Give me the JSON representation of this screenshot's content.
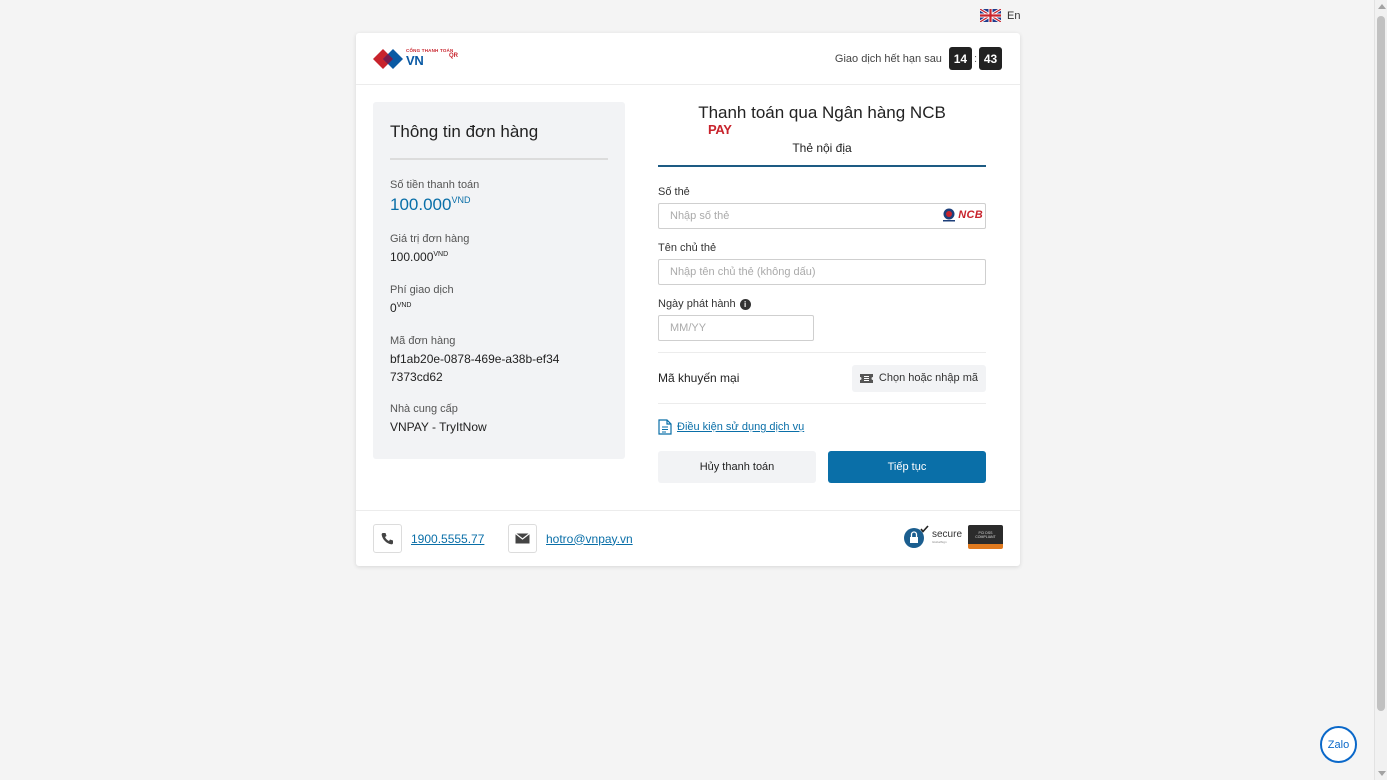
{
  "language": {
    "label": "En",
    "flag_icon": "uk-flag-icon"
  },
  "header": {
    "logo": {
      "small_text": "CỔNG THANH TOÁN",
      "brand_vn": "VN",
      "brand_pay": "PAY",
      "brand_qr": "QR"
    },
    "timer_label": "Giao dịch hết hạn sau",
    "minutes": "14",
    "separator": ":",
    "seconds": "43"
  },
  "order": {
    "title": "Thông tin đơn hàng",
    "amount_label": "Số tiền thanh toán",
    "amount_value": "100.000",
    "currency": "VND",
    "order_value_label": "Giá trị đơn hàng",
    "order_value": "100.000",
    "fee_label": "Phí giao dịch",
    "fee_value": "0",
    "order_code_label": "Mã đơn hàng",
    "order_code": "bf1ab20e-0878-469e-a38b-ef347373cd62",
    "provider_label": "Nhà cung cấp",
    "provider": "VNPAY - TryItNow"
  },
  "payment": {
    "title": "Thanh toán qua Ngân hàng NCB",
    "tab": "Thẻ nội địa",
    "card_number_label": "Số thẻ",
    "card_number_placeholder": "Nhập số thẻ",
    "bank_logo_text": "NCB",
    "holder_label": "Tên chủ thẻ",
    "holder_placeholder": "Nhập tên chủ thẻ (không dấu)",
    "issue_date_label": "Ngày phát hành",
    "issue_date_placeholder": "MM/YY",
    "promo_label": "Mã khuyến mại",
    "promo_button": "Chọn hoặc nhập mã",
    "terms_link": "Điều kiện sử dụng dịch vụ",
    "cancel_button": "Hủy thanh toán",
    "continue_button": "Tiếp tục"
  },
  "footer": {
    "phone": "1900.5555.77",
    "email": "hotro@vnpay.vn",
    "secure_text": "secure",
    "secure_sub": "GlobalSign",
    "pci_text": "PCI DSS COMPLIANT"
  },
  "zalo": {
    "label": "Zalo"
  },
  "colors": {
    "accent": "#0a6fa8",
    "brand_red": "#c8232c",
    "brand_blue": "#0a5aa4",
    "timer_bg": "#222222"
  }
}
